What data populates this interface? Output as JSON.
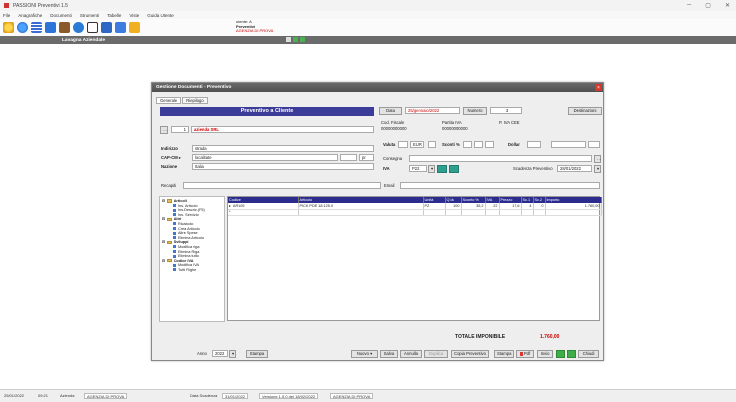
{
  "app": {
    "title": "PASSIONI Preventivi 1.5"
  },
  "menu": [
    "File",
    "Anagrafiche",
    "Documenti",
    "Strumenti",
    "Tabelle",
    "Viste",
    "Guida Utente"
  ],
  "toolbar_icons": [
    "bulb-icon",
    "globe-icon",
    "list-icon",
    "document-p-icon",
    "people-icon",
    "phone-icon",
    "checklist-icon",
    "window-icon",
    "grid-icon",
    "export-icon"
  ],
  "user": {
    "line1": "utente: A",
    "line2": "Preventivi",
    "line3": "AGENZIA DI PROVA"
  },
  "section": {
    "title": "Lavagna Aziendale"
  },
  "dialog": {
    "title": "Gestione Documenti - Preventivo",
    "close": "×",
    "tabs": [
      "Generale",
      "Riepilogo"
    ],
    "header": "Preventivo a Cliente",
    "data_btn": "Data",
    "date": "25/gennaio/2022",
    "numero_btn": "Numero",
    "numero": "3",
    "destinazioni_btn": "Destinazioni",
    "client_code": "1",
    "client_name": "azienda SRL",
    "cod_fiscale_lbl": "Cod. Fiscale",
    "cod_fiscale": "00000000000",
    "partita_iva_lbl": "Partita IVA",
    "partita_iva": "00000000000",
    "p_iva_cee_lbl": "P. IVA CEE",
    "indirizzo_lbl": "Indirizzo",
    "indirizzo": "strada",
    "cap_lbl": "CAP-CM ▸",
    "localita": "localitate",
    "prov": "pr",
    "nazione_lbl": "Nazione",
    "nazione": "Italia",
    "valuta_lbl": "Valuta",
    "valuta": "EUR",
    "scont_lbl": "Sconti %",
    "dollar_lbl": "Dollar",
    "consegna_lbl": "Consegna",
    "iva_lbl": "IVA",
    "iva": "P22",
    "scadenza_lbl": "Scadenza Preventivo",
    "scadenza": "28/01/2022",
    "recapiti_lbl": "Recapiti",
    "email_lbl": "Email"
  },
  "tree": [
    {
      "label": "Articoli",
      "folder": true
    },
    {
      "label": "Ins. Articolo",
      "folder": false
    },
    {
      "label": "Ins.Descriz.(F5)",
      "folder": false
    },
    {
      "label": "Ins. Servizio",
      "folder": false
    },
    {
      "label": "Altri",
      "folder": true
    },
    {
      "label": "Ricalcolo",
      "folder": false
    },
    {
      "label": "Crea Articolo",
      "folder": false
    },
    {
      "label": "Altre Spese",
      "folder": false
    },
    {
      "label": "Elimina Articolo",
      "folder": false
    },
    {
      "label": "Sviluppi",
      "folder": true
    },
    {
      "label": "Modifica riga",
      "folder": false
    },
    {
      "label": "Elimina Riga",
      "folder": false
    },
    {
      "label": "Elimina tutto",
      "folder": false
    },
    {
      "label": "Codice IVA",
      "folder": true
    },
    {
      "label": "Modifica IVA",
      "folder": false
    },
    {
      "label": "Tutti Righe",
      "folder": false
    }
  ],
  "grid": {
    "columns": [
      "Codice",
      "Articolo",
      "Unità",
      "Q.tà",
      "Sconto %",
      "IVA",
      "Prezzo",
      "Sc.1",
      "Sc.2",
      "Importo"
    ],
    "rows": [
      [
        "AR105",
        "PICK PDE 18.125.0",
        "PZ",
        "100",
        "35,2",
        "22",
        "17,6",
        "4",
        "0",
        "1.760,00"
      ]
    ]
  },
  "totals": {
    "label": "TOTALE IMPONIBILE",
    "value": "1.760,00"
  },
  "footer": {
    "anno_lbl": "Anno",
    "anno": "2022",
    "stampa_btn": "Stampa",
    "btns": [
      "Nuovo ▾",
      "Salva",
      "Annulla",
      "Duplica",
      "Copia Preventivo",
      "Stampa",
      "Pdf",
      "Invio",
      "Chiudi"
    ]
  },
  "statusbar": {
    "date": "25/01/2022",
    "time": "09:21",
    "azienda_lbl": "Azienda",
    "azienda": "AGENZIA DI PROVA",
    "scadenza_lbl": "Data Scadenza",
    "scadenza": "31/01/2022",
    "versione": "Versione 1.5.0 del 18/02/2022",
    "agenzia": "AGENZIA DI PROVA"
  },
  "colors": {
    "accent_blue": "#3b3b9a",
    "dark_bar": "#6b6b6b",
    "red_text": "#cc0000"
  }
}
